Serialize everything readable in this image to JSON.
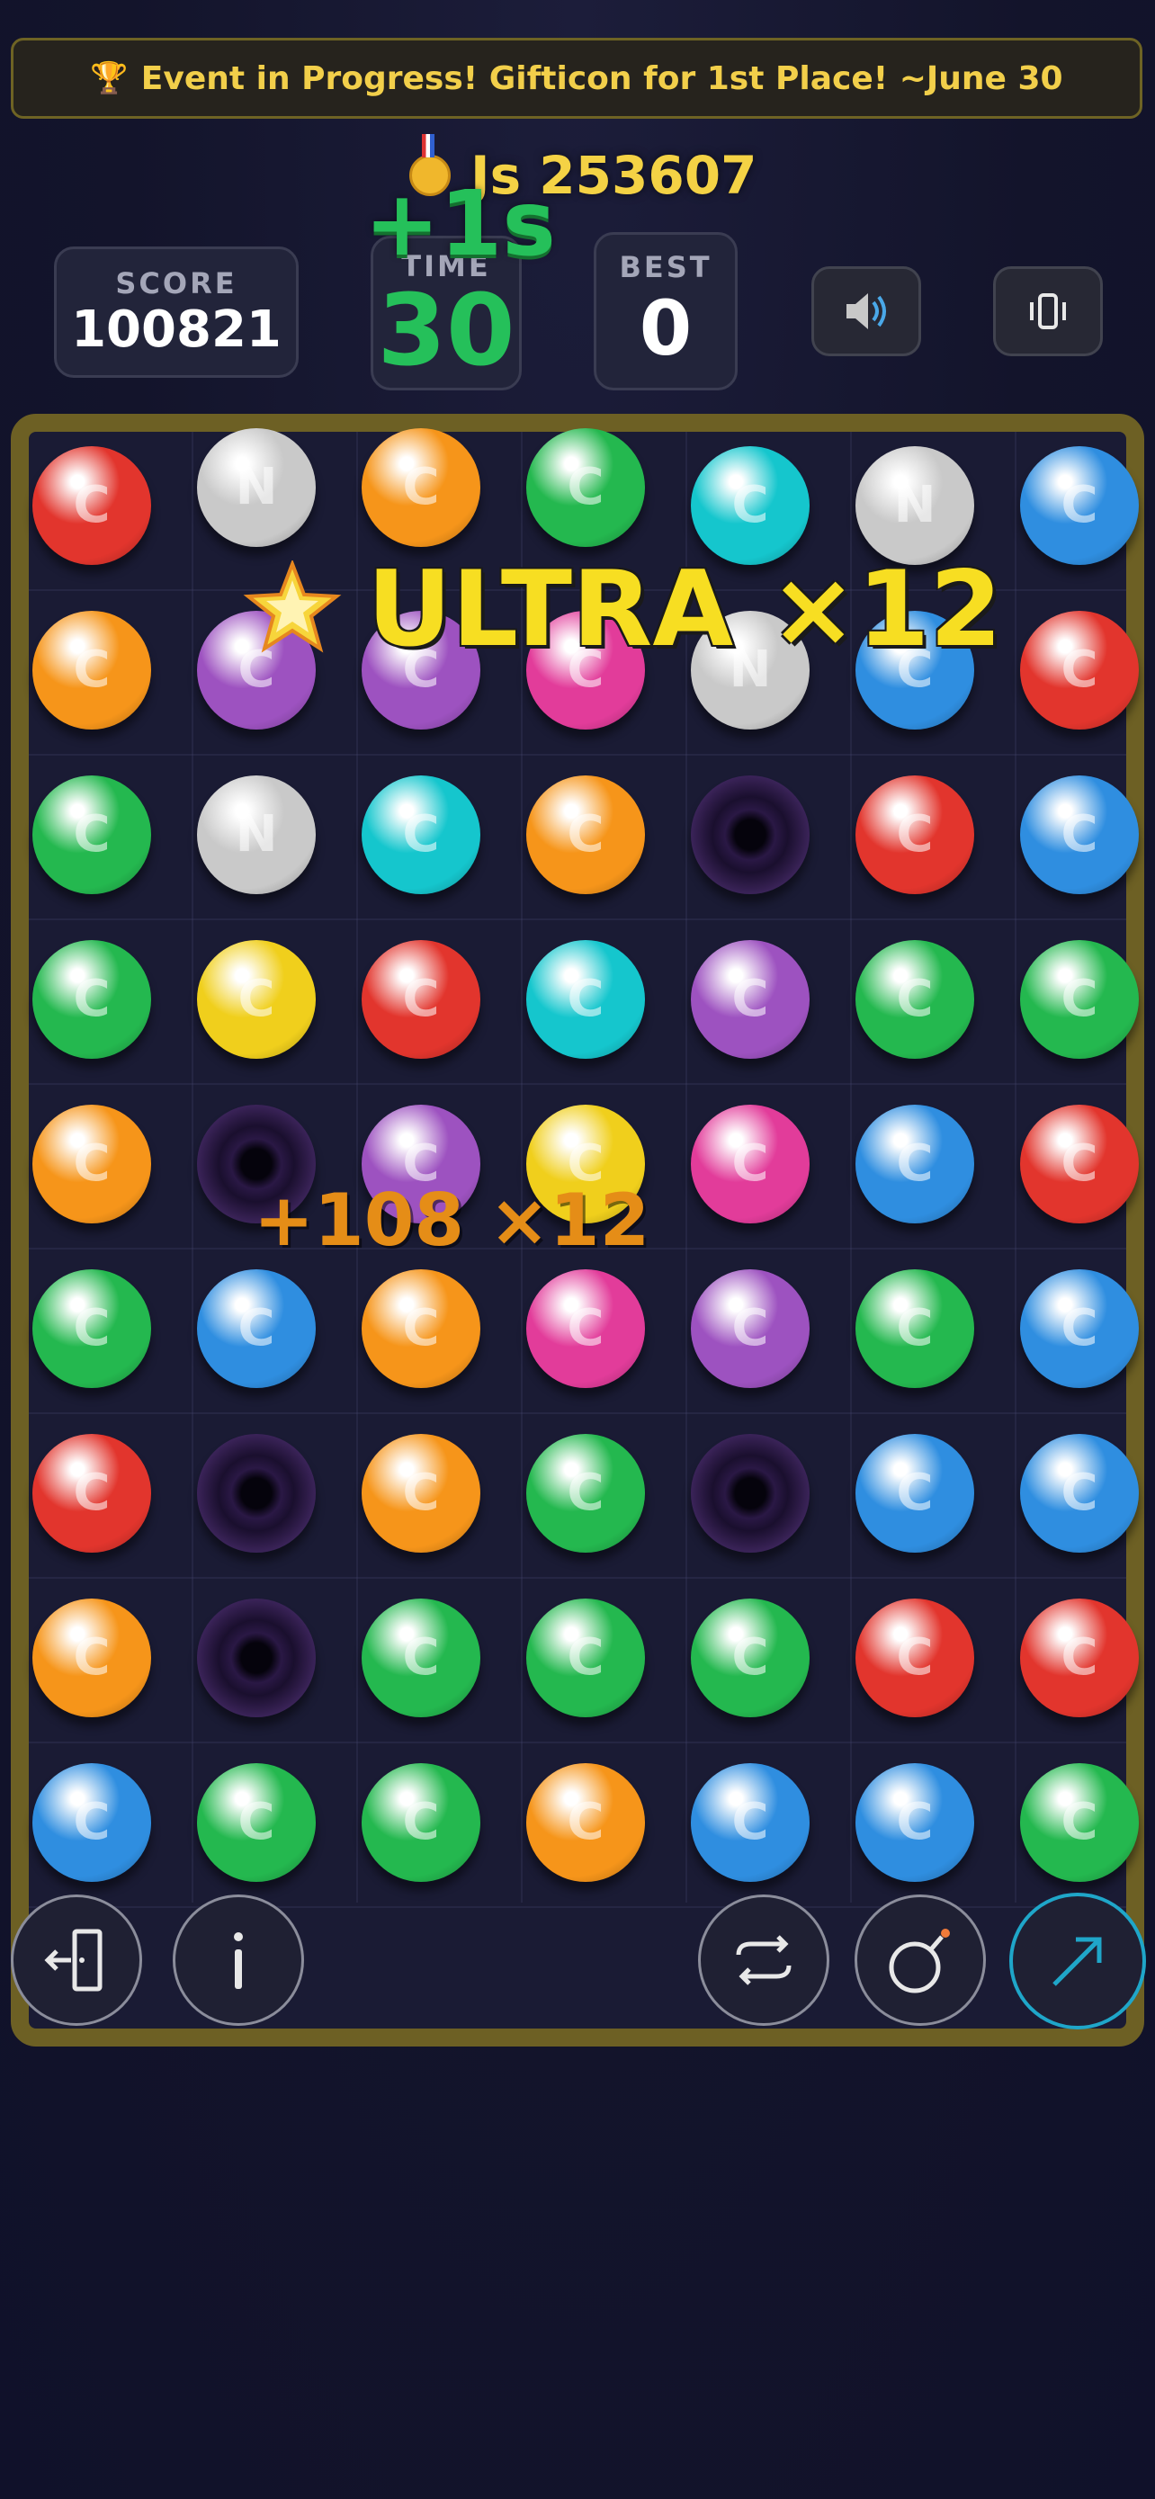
{
  "banner": {
    "icon": "trophy-icon",
    "text": "Event in Progress! Gifticon for 1st Place! ~June 30"
  },
  "player": {
    "icon": "medal-icon",
    "name_score": "Js 253607"
  },
  "stats": {
    "score_label": "SCORE",
    "score_value": "100821",
    "time_label": "TIME",
    "time_value": "30",
    "best_label": "BEST",
    "best_value": "0",
    "time_bonus": "+1s"
  },
  "toggles": {
    "sound": "speaker-icon",
    "vibration": "vibrate-icon"
  },
  "combo": {
    "icon": "star-burst-icon",
    "text": "ULTRA ×12"
  },
  "score_popup": "+108 ×12",
  "board": {
    "columns": 7,
    "rows": [
      [
        "red",
        "silver",
        "orange",
        "green",
        "cyan",
        "silver",
        "blue"
      ],
      [
        "orange",
        "purple",
        "purple",
        "pink",
        "silver",
        "blue",
        "red"
      ],
      [
        "green",
        "silver",
        "cyan",
        "orange",
        "hole",
        "red",
        "blue"
      ],
      [
        "green",
        "yellow",
        "red",
        "cyan",
        "purple",
        "green",
        "green"
      ],
      [
        "orange",
        "hole",
        "purple",
        "yellow",
        "pink",
        "blue",
        "red"
      ],
      [
        "green",
        "blue",
        "orange",
        "pink",
        "purple",
        "green",
        "blue"
      ],
      [
        "red",
        "hole",
        "orange",
        "green",
        "hole",
        "blue",
        "blue"
      ],
      [
        "orange",
        "hole",
        "green",
        "green",
        "green",
        "red",
        "red"
      ],
      [
        "blue",
        "green",
        "green",
        "orange",
        "blue",
        "blue",
        "green"
      ]
    ]
  },
  "palette": {
    "red": "#e2352d",
    "orange": "#f6951a",
    "green": "#24b84f",
    "cyan": "#15c6cd",
    "silver": "#c9c9c9",
    "blue": "#2f8ee0",
    "purple": "#9d52c0",
    "pink": "#e23c9a",
    "yellow": "#f0cf1c",
    "hole": "#2e1a45"
  },
  "toolbar": {
    "exit": "exit-icon",
    "info": "info-icon",
    "shuffle": "shuffle-icon",
    "bomb": "bomb-icon",
    "hint": "arrow-up-right-icon"
  }
}
